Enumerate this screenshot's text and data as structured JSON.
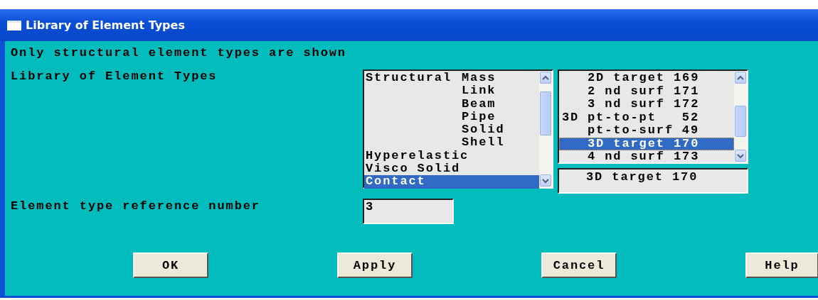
{
  "window": {
    "title": "Library of Element Types"
  },
  "note": "Only structural element types are shown",
  "library": {
    "label": "Library of Element Types",
    "categories": [
      {
        "group": "Structural",
        "type": "Mass",
        "selected": false
      },
      {
        "type": "Link",
        "selected": false
      },
      {
        "type": "Beam",
        "selected": false
      },
      {
        "type": "Pipe",
        "selected": false
      },
      {
        "type": "Solid",
        "selected": false
      },
      {
        "type": "Shell",
        "selected": false
      },
      {
        "group": "Hyperelastic",
        "selected": false
      },
      {
        "group": "Visco Solid",
        "selected": false
      },
      {
        "group": "Contact",
        "selected": true
      }
    ],
    "types": [
      {
        "name": "2D target",
        "number": "169",
        "selected": false
      },
      {
        "name": "2 nd surf",
        "number": "171",
        "selected": false
      },
      {
        "name": "3 nd surf",
        "number": "172",
        "selected": false
      },
      {
        "group": "3D",
        "name": "pt-to-pt",
        "number": "52",
        "selected": false
      },
      {
        "name": "pt-to-surf",
        "number": "49",
        "selected": false
      },
      {
        "name": "3D target",
        "number": "170",
        "selected": true
      },
      {
        "name": "4 nd surf",
        "number": "173",
        "selected": false
      }
    ],
    "selection": "3D target 170"
  },
  "reference": {
    "label": "Element type reference number",
    "value": "3"
  },
  "buttons": [
    "OK",
    "Apply",
    "Cancel",
    "Help"
  ]
}
